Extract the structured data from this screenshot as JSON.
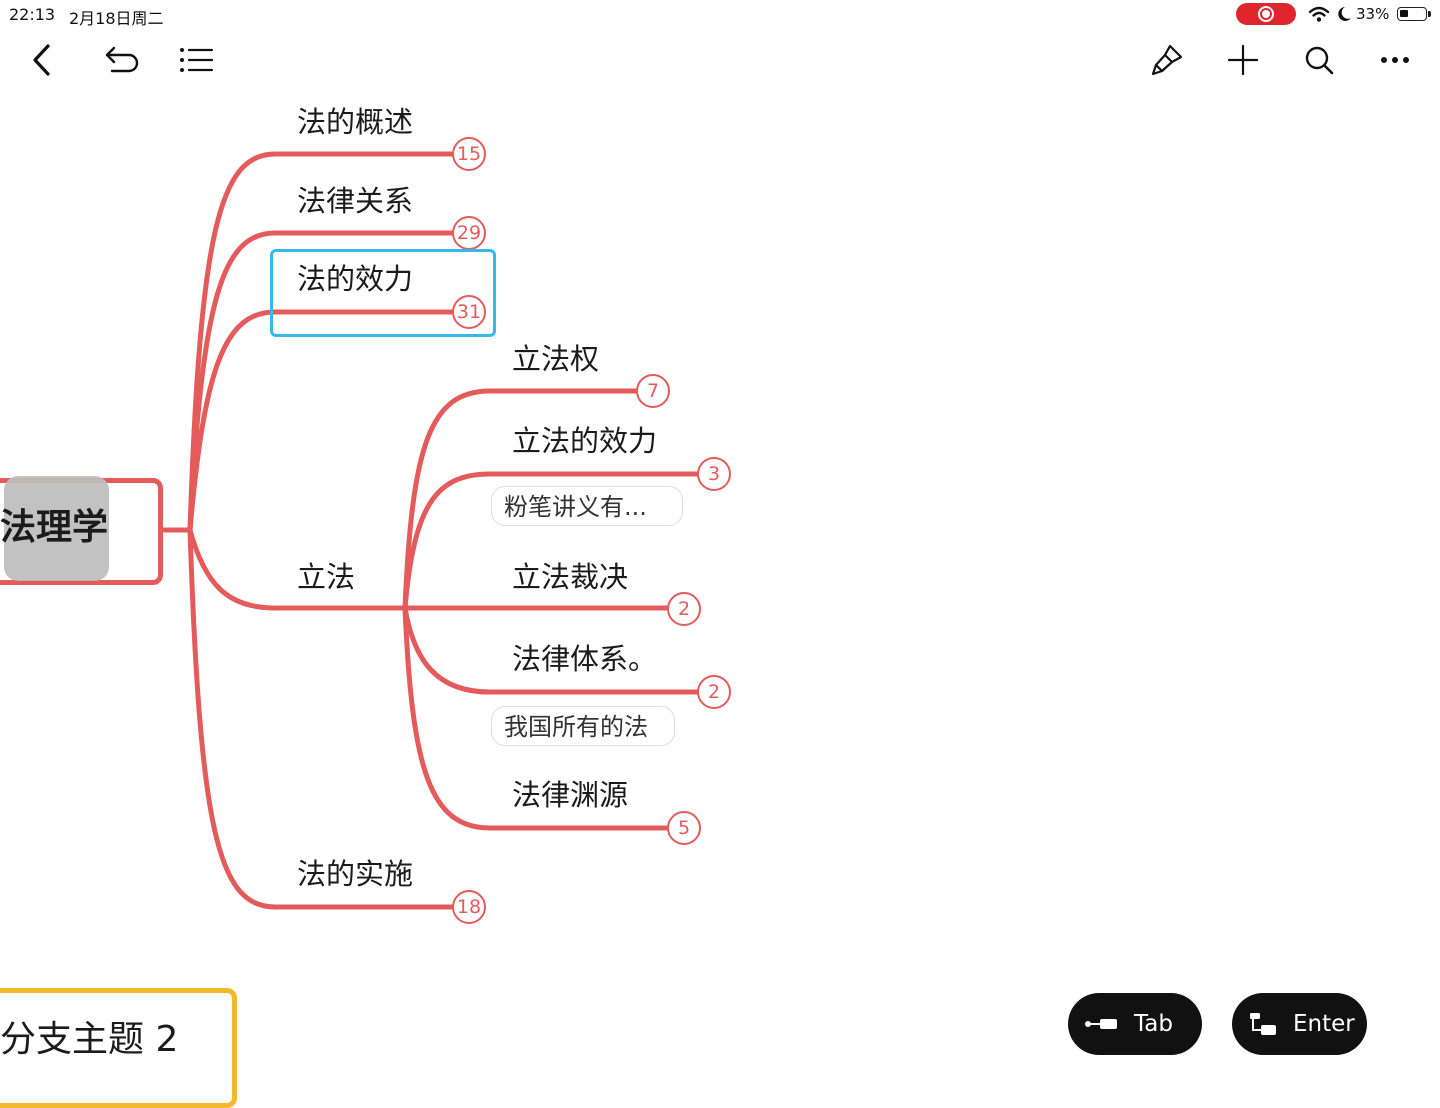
{
  "status_bar": {
    "time": "22:13",
    "date": "2月18日周二",
    "battery": "33%",
    "record_color": "#e0262d"
  },
  "toolbar": {
    "left": [
      "back-icon",
      "undo-icon",
      "outline-list-icon"
    ],
    "right": [
      "style-brush-icon",
      "add-icon",
      "search-icon",
      "more-icon"
    ]
  },
  "mindmap": {
    "root": "法理学",
    "branch_color": "#e45b5b",
    "selection_color": "#36b8ea",
    "topics": [
      {
        "label": "法的概述",
        "count": "15"
      },
      {
        "label": "法律关系",
        "count": "29"
      },
      {
        "label": "法的效力",
        "count": "31",
        "selected": true
      },
      {
        "label": "立法",
        "children": [
          {
            "label": "立法权",
            "count": "7"
          },
          {
            "label": "立法的效力",
            "count": "3",
            "note": "粉笔讲义有..."
          },
          {
            "label": "立法裁决",
            "count": "2"
          },
          {
            "label": "法律体系。",
            "count": "2",
            "note": "我国所有的法"
          },
          {
            "label": "法律渊源",
            "count": "5"
          }
        ]
      },
      {
        "label": "法的实施",
        "count": "18"
      }
    ],
    "floating_topic": "分支主题 2",
    "floating_color": "#f3b92c"
  },
  "keyboard_helpers": {
    "tab_label": "Tab",
    "enter_label": "Enter"
  }
}
